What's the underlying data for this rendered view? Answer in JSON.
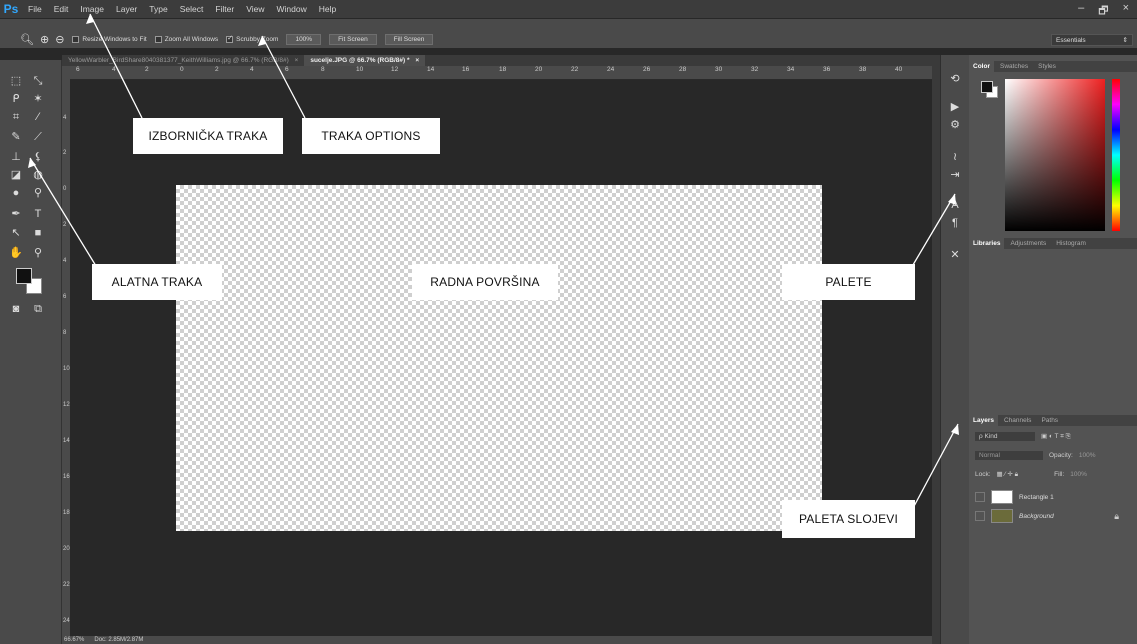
{
  "menubar": {
    "logo": "Ps",
    "items": [
      "File",
      "Edit",
      "Image",
      "Layer",
      "Type",
      "Select",
      "Filter",
      "View",
      "Window",
      "Help"
    ],
    "window_controls": [
      "–",
      "🗗",
      "×"
    ]
  },
  "options": {
    "resize_windows": "Resize Windows to Fit",
    "zoom_all": "Zoom All Windows",
    "scrubby_zoom": "Scrubby Zoom",
    "btn_100": "100%",
    "btn_fit": "Fit Screen",
    "btn_fill": "Fill Screen",
    "workspace": "Essentials"
  },
  "tabs": [
    {
      "label": "YellowWarbler_BirdShare8040381377_KeithWilliams.jpg @ 66.7% (RGB/8#)",
      "close": "×"
    },
    {
      "label": "sucelje.JPG @ 66.7% (RGB/8#) *",
      "close": "×"
    }
  ],
  "ruler_top": [
    "6",
    "4",
    "2",
    "0",
    "2",
    "4",
    "6",
    "8",
    "10",
    "12",
    "14",
    "16",
    "18",
    "20",
    "22",
    "24",
    "26",
    "28",
    "30",
    "32",
    "34",
    "36",
    "38",
    "40"
  ],
  "ruler_left": [
    "4",
    "2",
    "0",
    "2",
    "4",
    "6",
    "8",
    "10",
    "12",
    "14",
    "16",
    "18",
    "20",
    "22",
    "24"
  ],
  "status": {
    "zoom": "66.67%",
    "doc": "Doc: 2.85M/2.87M"
  },
  "color_panel": {
    "tabs": [
      "Color",
      "Swatches",
      "Styles"
    ]
  },
  "libraries_panel": {
    "tabs": [
      "Libraries",
      "Adjustments",
      "Histogram"
    ]
  },
  "layers_panel": {
    "tabs": [
      "Layers",
      "Channels",
      "Paths"
    ],
    "kind": "ρ Kind",
    "blend_mode": "Normal",
    "opacity_label": "Opacity:",
    "opacity_value": "100%",
    "lock_label": "Lock:",
    "fill_label": "Fill:",
    "fill_value": "100%",
    "layers": [
      "Rectangle 1",
      "Background"
    ]
  },
  "callouts": {
    "menu_bar": "IZBORNIČKA TRAKA",
    "options_bar": "TRAKA OPTIONS",
    "toolbar": "ALATNA TRAKA",
    "workspace": "RADNA POVRŠINA",
    "palettes": "PALETE",
    "layers_palette": "PALETA SLOJEVI"
  },
  "colors": {
    "accent": "#31a8ff",
    "ui_dark": "#282828",
    "ui_panel": "#535353"
  }
}
